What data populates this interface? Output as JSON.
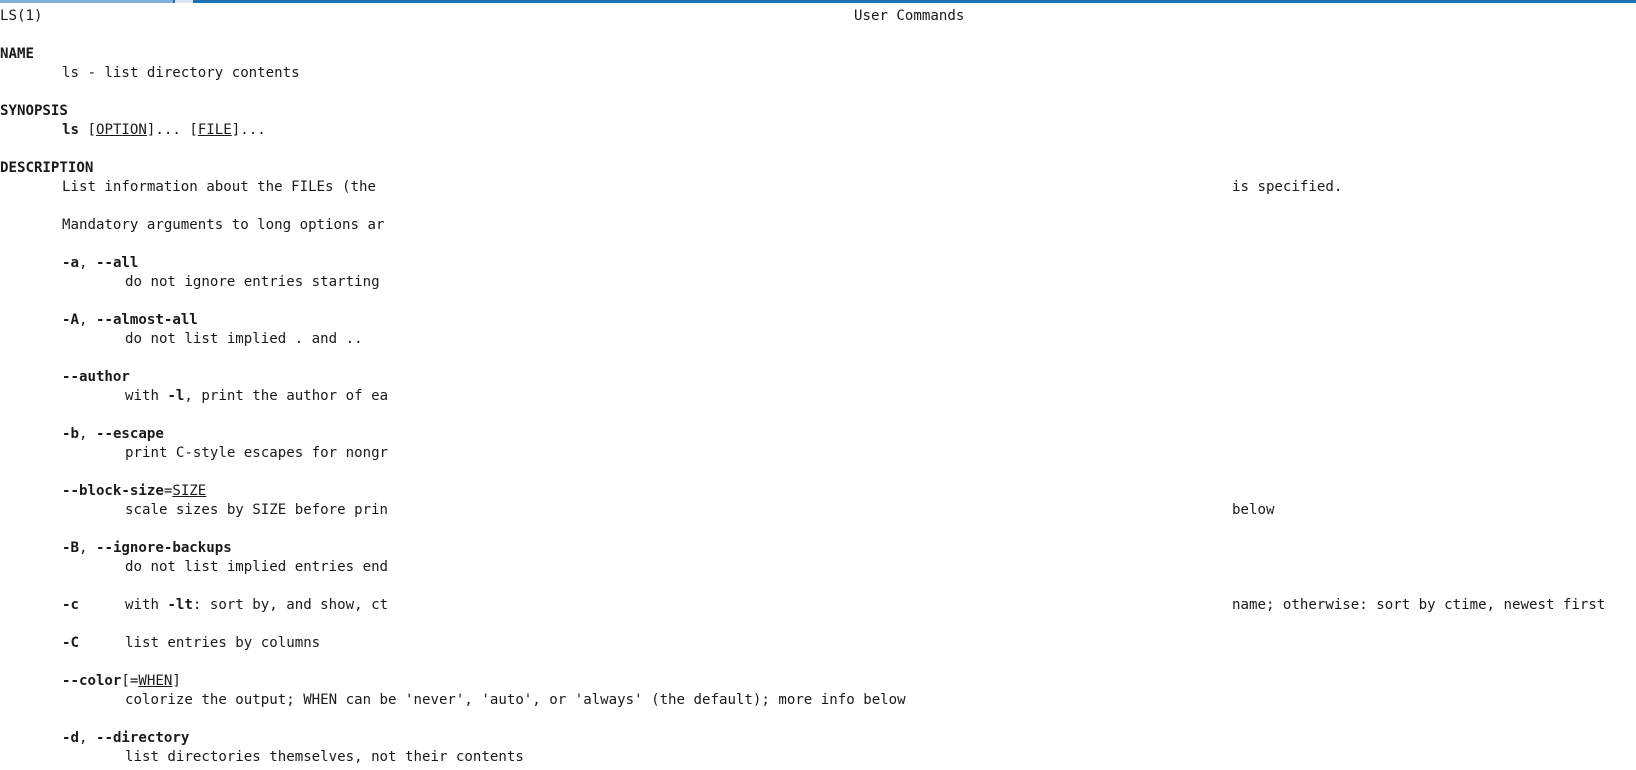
{
  "header": {
    "left": "LS(1)",
    "center": "User Commands"
  },
  "name_section": {
    "heading": "NAME",
    "text": "ls - list directory contents"
  },
  "synopsis": {
    "heading": "SYNOPSIS",
    "cmd": "ls",
    "p1": " [",
    "option": "OPTION",
    "p2": "]... [",
    "file": "FILE",
    "p3": "]..."
  },
  "description": {
    "heading": "DESCRIPTION",
    "line1_left": "List information about the FILEs (the",
    "line1_right": "is specified.",
    "line2": "Mandatory arguments to long options ar"
  },
  "options": {
    "a": {
      "short": "-a",
      "sep": ", ",
      "long": "--all",
      "desc": "do not ignore entries starting"
    },
    "A": {
      "short": "-A",
      "sep": ", ",
      "long": "--almost-all",
      "desc": "do not list implied . and .."
    },
    "author": {
      "long": "--author",
      "desc_pre": "with ",
      "desc_flag": "-l",
      "desc_post": ", print the author of ea"
    },
    "b": {
      "short": "-b",
      "sep": ", ",
      "long": "--escape",
      "desc": "print C-style escapes for nongr"
    },
    "block_size": {
      "long": "--block-size",
      "eq": "=",
      "arg": "SIZE",
      "desc_left": "scale sizes by SIZE before prin",
      "desc_right": "below"
    },
    "B": {
      "short": "-B",
      "sep": ", ",
      "long": "--ignore-backups",
      "desc": "do not list implied entries end"
    },
    "c": {
      "short": "-c",
      "desc_pre": "with ",
      "desc_flag": "-lt",
      "desc_post": ": sort by, and show, ct",
      "desc_right": "name; otherwise: sort by ctime, newest first"
    },
    "C": {
      "short": "-C",
      "desc": "list entries by columns"
    },
    "color": {
      "long": "--color",
      "bracket_open": "[=",
      "arg": "WHEN",
      "bracket_close": "]",
      "desc": "colorize the output; WHEN can be 'never', 'auto', or 'always' (the default); more info below"
    },
    "d": {
      "short": "-d",
      "sep": ", ",
      "long": "--directory",
      "desc": "list directories themselves, not their contents"
    }
  }
}
